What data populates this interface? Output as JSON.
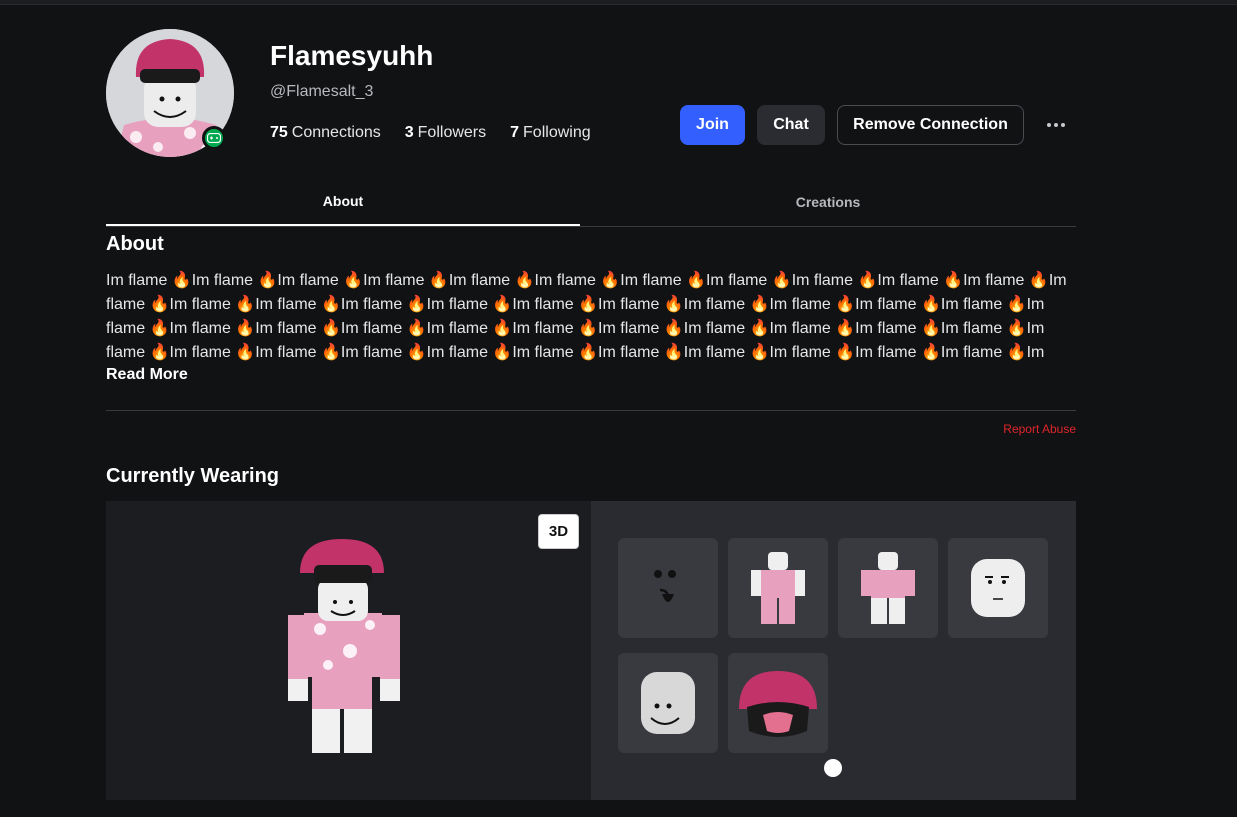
{
  "profile": {
    "display_name": "Flamesyuhh",
    "handle": "@Flamesalt_3",
    "presence": "in-game",
    "stats": {
      "connections_count": "75",
      "connections_label": "Connections",
      "followers_count": "3",
      "followers_label": "Followers",
      "following_count": "7",
      "following_label": "Following"
    }
  },
  "actions": {
    "join": "Join",
    "chat": "Chat",
    "remove": "Remove Connection"
  },
  "tabs": [
    {
      "label": "About",
      "active": true
    },
    {
      "label": "Creations",
      "active": false
    }
  ],
  "about": {
    "title": "About",
    "text": "Im flame 🔥Im flame 🔥Im flame 🔥Im flame 🔥Im flame 🔥Im flame 🔥Im flame 🔥Im flame 🔥Im flame 🔥Im flame 🔥Im flame 🔥Im flame 🔥Im flame 🔥Im flame 🔥Im flame 🔥Im flame 🔥Im flame 🔥Im flame 🔥Im flame 🔥Im flame 🔥Im flame 🔥Im flame 🔥Im flame 🔥Im flame 🔥Im flame 🔥Im flame 🔥Im flame 🔥Im flame 🔥Im flame 🔥Im flame 🔥Im flame 🔥Im flame 🔥Im flame 🔥Im flame 🔥Im flame 🔥Im flame 🔥Im flame 🔥Im flame 🔥Im flame 🔥Im flame 🔥Im flame 🔥Im flame 🔥Im flame 🔥Im flame 🔥Im flame",
    "read_more": "Read More"
  },
  "report_abuse": "Report Abuse",
  "currently_wearing": {
    "title": "Currently Wearing",
    "toggle_3d": "3D",
    "items": [
      "face-item",
      "shirt-item",
      "pants-item",
      "head-item",
      "smile-head-item",
      "hat-item"
    ]
  },
  "colors": {
    "accent": "#335fff",
    "report": "#e0252b",
    "presence": "#00a84f",
    "hat": "#c2336a"
  }
}
